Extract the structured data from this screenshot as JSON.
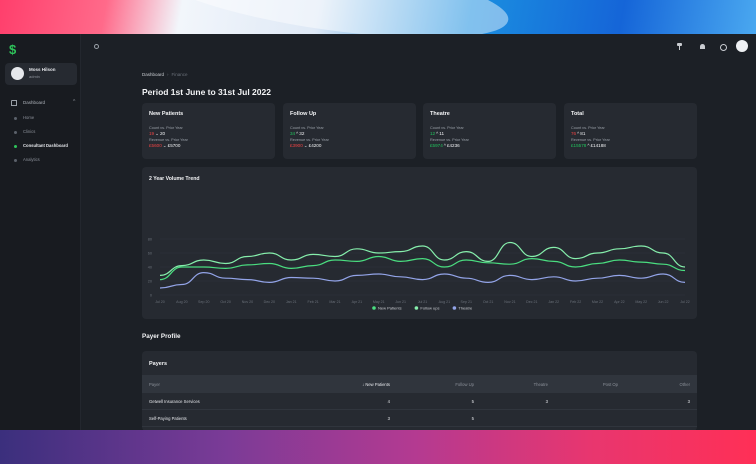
{
  "app": {
    "logo": "$",
    "user": {
      "name": "Moss Hilson",
      "role": "admin"
    }
  },
  "nav": {
    "section": "Dashboard",
    "items": [
      {
        "label": "Home",
        "active": false
      },
      {
        "label": "Clinics",
        "active": false
      },
      {
        "label": "Consultant Dashboard",
        "active": true
      },
      {
        "label": "Analytics",
        "active": false
      }
    ]
  },
  "breadcrumb": {
    "root": "Dashboard",
    "current": "Finance"
  },
  "period_title": "Period 1st June to 31st Jul 2022",
  "cards": [
    {
      "title": "New Patients",
      "count_label": "Count vs. Prior Year",
      "count_prior": "19",
      "count_dir": "down",
      "count_current": "20",
      "revenue_label": "Revenue vs. Prior Year",
      "revenue_prior": "£5600",
      "revenue_dir": "down",
      "revenue_current": "£5700"
    },
    {
      "title": "Follow Up",
      "count_label": "Count vs. Prior Year",
      "count_prior": "34",
      "count_dir": "up",
      "count_current": "32",
      "revenue_label": "Revenue vs. Prior Year",
      "revenue_prior": "£3900",
      "revenue_dir": "down",
      "revenue_current": "£4200"
    },
    {
      "title": "Theatre",
      "count_label": "Count vs. Prior Year",
      "count_prior": "12",
      "count_dir": "up",
      "count_current": "11",
      "revenue_label": "Revenue vs. Prior Year",
      "revenue_prior": "£5974",
      "revenue_dir": "up",
      "revenue_current": "£4236"
    },
    {
      "title": "Total",
      "count_label": "Count vs. Prior Year",
      "count_prior": "76",
      "count_dir": "up",
      "count_current": "81",
      "revenue_label": "Revenue vs. Prior Year",
      "revenue_prior": "£15578",
      "revenue_dir": "up",
      "revenue_current": "£14188"
    }
  ],
  "chart_data": {
    "type": "line",
    "title": "2 Year Volume Trend",
    "ylim": [
      0,
      100
    ],
    "yticks": [
      0,
      20,
      40,
      60,
      80
    ],
    "grid": true,
    "legend_position": "bottom",
    "x": [
      "Jul 20",
      "Aug 20",
      "Sep 20",
      "Oct 20",
      "Nov 20",
      "Dec 20",
      "Jan 21",
      "Feb 21",
      "Mar 21",
      "Apr 21",
      "May 21",
      "Jun 21",
      "Jul 21",
      "Aug 21",
      "Sep 21",
      "Oct 21",
      "Nov 21",
      "Dec 21",
      "Jan 22",
      "Feb 22",
      "Mar 22",
      "Apr 22",
      "May 22",
      "Jun 22",
      "Jul 22"
    ],
    "series": [
      {
        "name": "New Patients",
        "color": "#4ade80",
        "values": [
          22,
          40,
          40,
          38,
          43,
          45,
          38,
          42,
          50,
          48,
          55,
          48,
          52,
          40,
          50,
          46,
          44,
          52,
          48,
          40,
          45,
          50,
          47,
          44,
          35
        ]
      },
      {
        "name": "Follow ups",
        "color": "#86efac",
        "values": [
          28,
          42,
          50,
          45,
          55,
          60,
          50,
          58,
          55,
          66,
          60,
          62,
          70,
          50,
          62,
          48,
          75,
          55,
          68,
          52,
          60,
          66,
          70,
          60,
          40
        ]
      },
      {
        "name": "Theatre",
        "color": "#93a4e8",
        "values": [
          10,
          15,
          32,
          24,
          22,
          18,
          25,
          24,
          20,
          28,
          30,
          26,
          22,
          30,
          24,
          18,
          28,
          22,
          26,
          20,
          24,
          28,
          24,
          30,
          18
        ]
      }
    ]
  },
  "payer_profile": {
    "heading": "Payer Profile",
    "card_title": "Payers",
    "columns": [
      "Payer",
      "New Patients",
      "Follow Up",
      "Theatre",
      "Post Op",
      "Other"
    ],
    "rows": [
      [
        "Getwell Insurance Services",
        "4",
        "5",
        "3",
        "",
        "3"
      ],
      [
        "Self-Paying Patients",
        "3",
        "5",
        "",
        "",
        ""
      ]
    ]
  }
}
